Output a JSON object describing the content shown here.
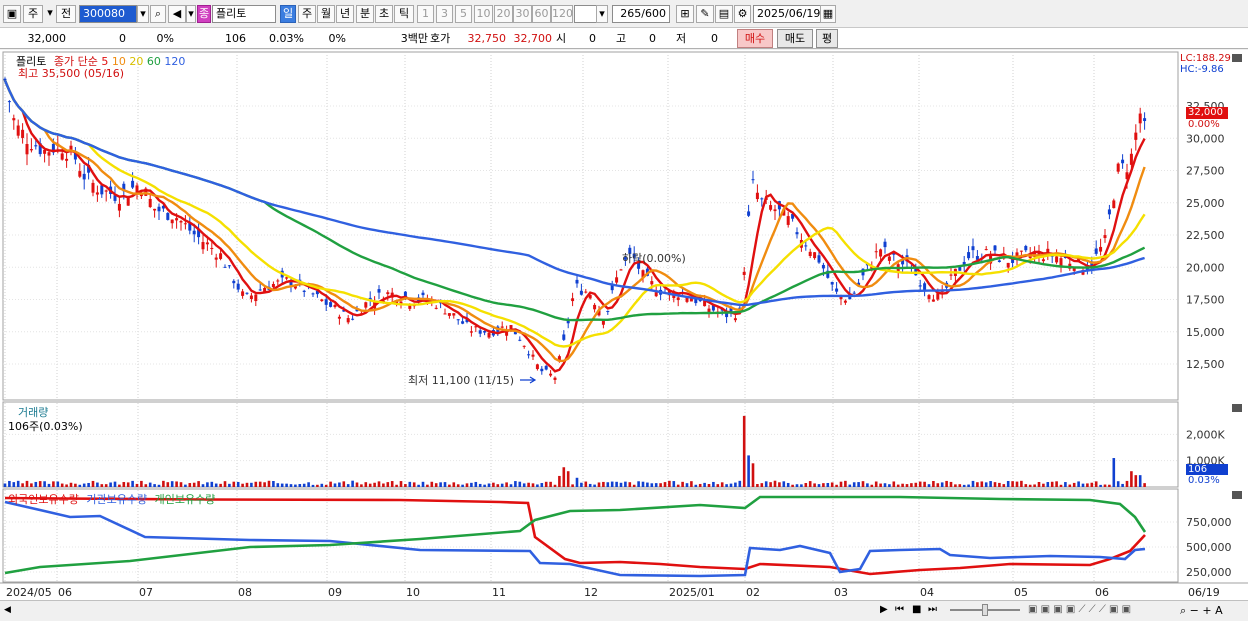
{
  "toolbar": {
    "period_label": "주",
    "prev_label": "전",
    "code_value": "300080",
    "name_value": "플리토",
    "name_badge": "종",
    "periods": [
      "일",
      "주",
      "월",
      "년",
      "분",
      "초",
      "틱"
    ],
    "intervals": [
      "1",
      "3",
      "5",
      "10",
      "20",
      "30",
      "60",
      "120"
    ],
    "count_value": "265",
    "count_total": "/600",
    "date_value": "2025/06/19"
  },
  "quote": {
    "price": "32,000",
    "change": "0",
    "change_pct": "0%",
    "volume": "106",
    "volume_pct": "0.03%",
    "turnover_pct": "0%",
    "amount_label": "3백만",
    "bid_ask_label": "호가",
    "ask": "32,750",
    "bid": "32,700",
    "open_label": "시",
    "open": "0",
    "high_label": "고",
    "high": "0",
    "low_label": "저",
    "low": "0",
    "buy_label": "매수",
    "sell_label": "매도",
    "eval_label": "평"
  },
  "price_panel": {
    "name": "플리토",
    "ma_label": "종가 단순",
    "ma_periods": [
      "5",
      "10",
      "20",
      "60",
      "120"
    ],
    "ma_colors": [
      "#e01010",
      "#f08c10",
      "#f5e000",
      "#20a040",
      "#3060e0"
    ],
    "high_note": "최고 35,500 (05/16)",
    "low_note": "최저 11,100 (11/15)",
    "cross_note": "하락(0.00%)",
    "lc_label": "LC:188.29",
    "hc_label": "HC:-9.86",
    "price_tag": "32,000",
    "pct_tag": "0.00%",
    "y_ticks": [
      "32,500",
      "30,000",
      "27,500",
      "25,000",
      "22,500",
      "20,000",
      "17,500",
      "15,000",
      "12,500"
    ]
  },
  "volume_panel": {
    "title": "거래량",
    "subtitle": "106주(0.03%)",
    "y_ticks": [
      "2,000K",
      "1,000K"
    ],
    "tag": "106",
    "tag_pct": "0.03%"
  },
  "holdings_panel": {
    "series": [
      "외국인보유수량",
      "기관보유수량",
      "개인보유수량"
    ],
    "colors": [
      "#e01010",
      "#3060e0",
      "#20a040"
    ],
    "y_ticks": [
      "750,000",
      "500,000",
      "250,000"
    ]
  },
  "x_axis": [
    "2024/05",
    "06",
    "07",
    "08",
    "09",
    "10",
    "11",
    "12",
    "2025/01",
    "02",
    "03",
    "04",
    "05",
    "06"
  ],
  "x_axis_right": "06/19"
}
